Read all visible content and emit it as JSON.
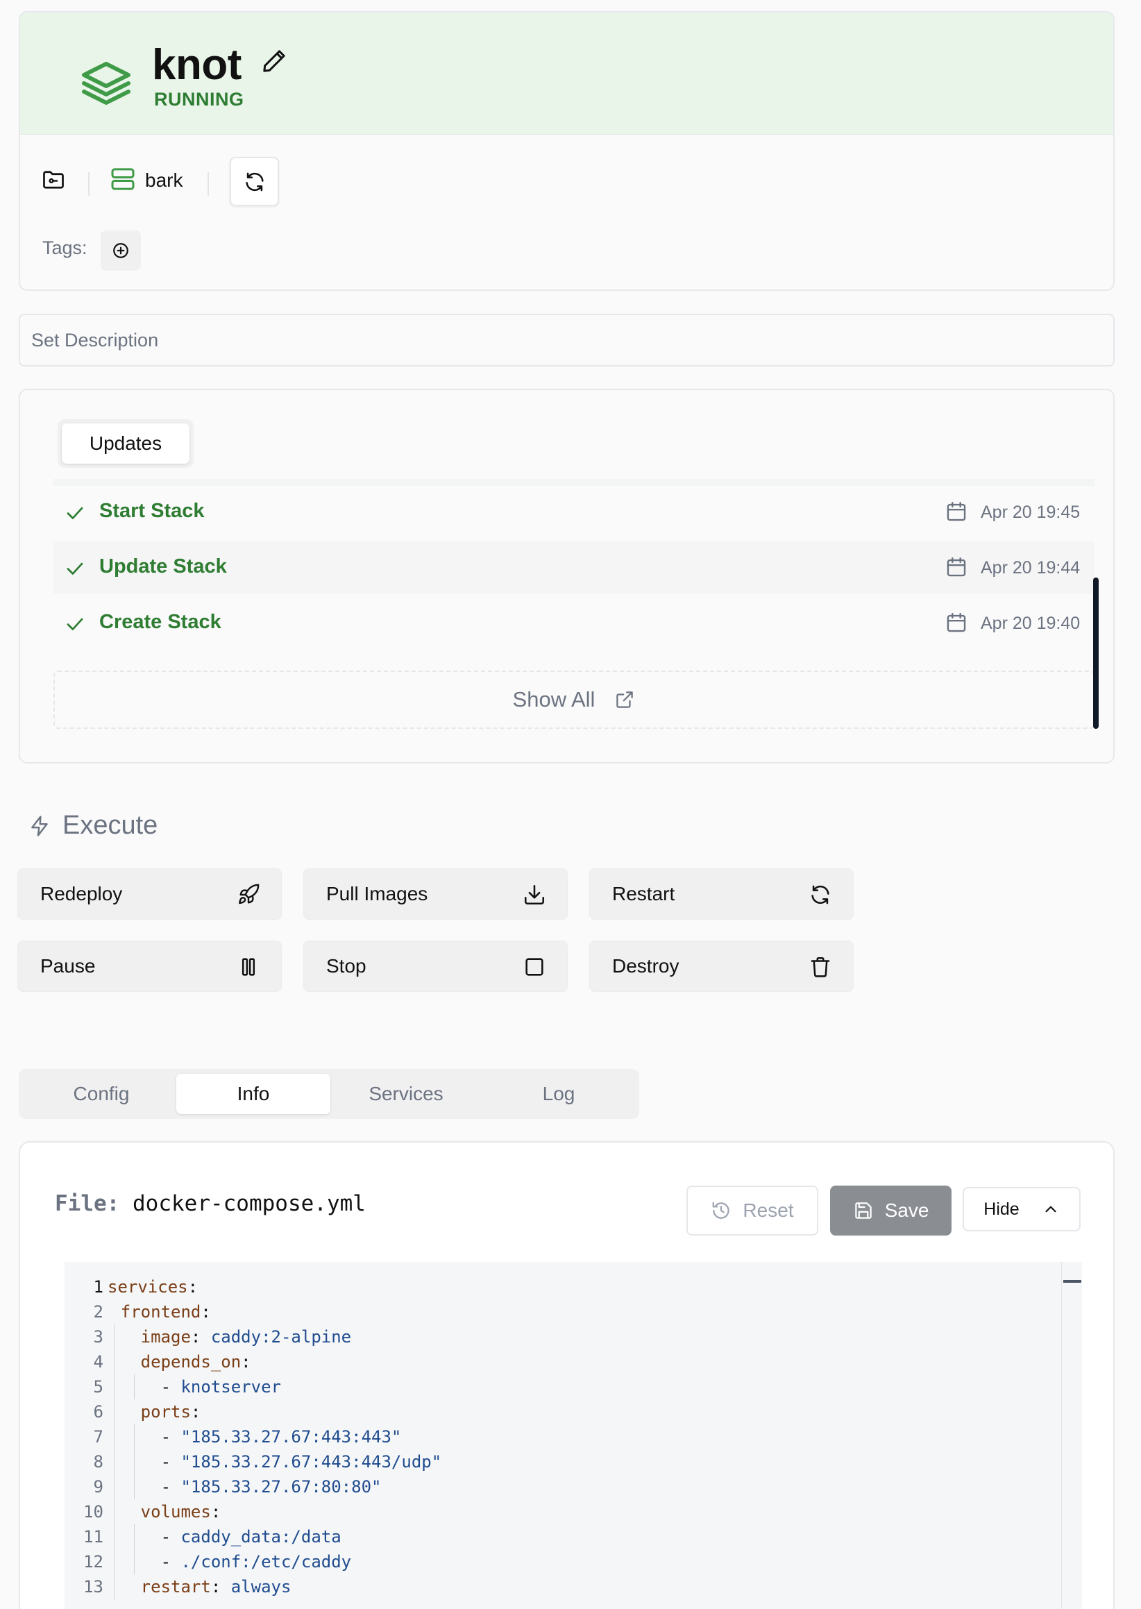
{
  "stack": {
    "name": "knot",
    "status": "RUNNING",
    "server": "bark",
    "tags_label": "Tags:",
    "description_placeholder": "Set Description"
  },
  "updates": {
    "tab_label": "Updates",
    "items": [
      {
        "name": "Start Stack",
        "date": "Apr 20 19:45"
      },
      {
        "name": "Update Stack",
        "date": "Apr 20 19:44"
      },
      {
        "name": "Create Stack",
        "date": "Apr 20 19:40"
      }
    ],
    "show_all": "Show All"
  },
  "execute": {
    "title": "Execute",
    "actions": [
      {
        "label": "Redeploy",
        "icon": "rocket-icon"
      },
      {
        "label": "Pull Images",
        "icon": "download-icon"
      },
      {
        "label": "Restart",
        "icon": "refresh-icon"
      },
      {
        "label": "Pause",
        "icon": "pause-icon"
      },
      {
        "label": "Stop",
        "icon": "stop-icon"
      },
      {
        "label": "Destroy",
        "icon": "trash-icon"
      }
    ]
  },
  "tabs": [
    {
      "label": "Config",
      "active": false
    },
    {
      "label": "Info",
      "active": true
    },
    {
      "label": "Services",
      "active": false
    },
    {
      "label": "Log",
      "active": false
    }
  ],
  "file": {
    "label": "File:",
    "name": "docker-compose.yml",
    "reset": "Reset",
    "save": "Save",
    "hide": "Hide"
  },
  "code": [
    {
      "n": "1",
      "key": "services",
      "punct": ":",
      "val": ""
    },
    {
      "n": "2",
      "key": "frontend",
      "punct": ":",
      "val": ""
    },
    {
      "n": "3",
      "key": "image",
      "punct": ": ",
      "val": "caddy:2-alpine"
    },
    {
      "n": "4",
      "key": "depends_on",
      "punct": ":",
      "val": ""
    },
    {
      "n": "5",
      "key": "",
      "punct": "- ",
      "val": "knotserver"
    },
    {
      "n": "6",
      "key": "ports",
      "punct": ":",
      "val": ""
    },
    {
      "n": "7",
      "key": "",
      "punct": "- ",
      "val": "\"185.33.27.67:443:443\""
    },
    {
      "n": "8",
      "key": "",
      "punct": "- ",
      "val": "\"185.33.27.67:443:443/udp\""
    },
    {
      "n": "9",
      "key": "",
      "punct": "- ",
      "val": "\"185.33.27.67:80:80\""
    },
    {
      "n": "10",
      "key": "volumes",
      "punct": ":",
      "val": ""
    },
    {
      "n": "11",
      "key": "",
      "punct": "- ",
      "val": "caddy_data:/data"
    },
    {
      "n": "12",
      "key": "",
      "punct": "- ",
      "val": "./conf:/etc/caddy"
    },
    {
      "n": "13",
      "key": "restart",
      "punct": ": ",
      "val": "always"
    }
  ],
  "colors": {
    "accent_green": "#2e7d32",
    "header_bg": "#eaf5ea",
    "save_button": "#8a8d91"
  }
}
